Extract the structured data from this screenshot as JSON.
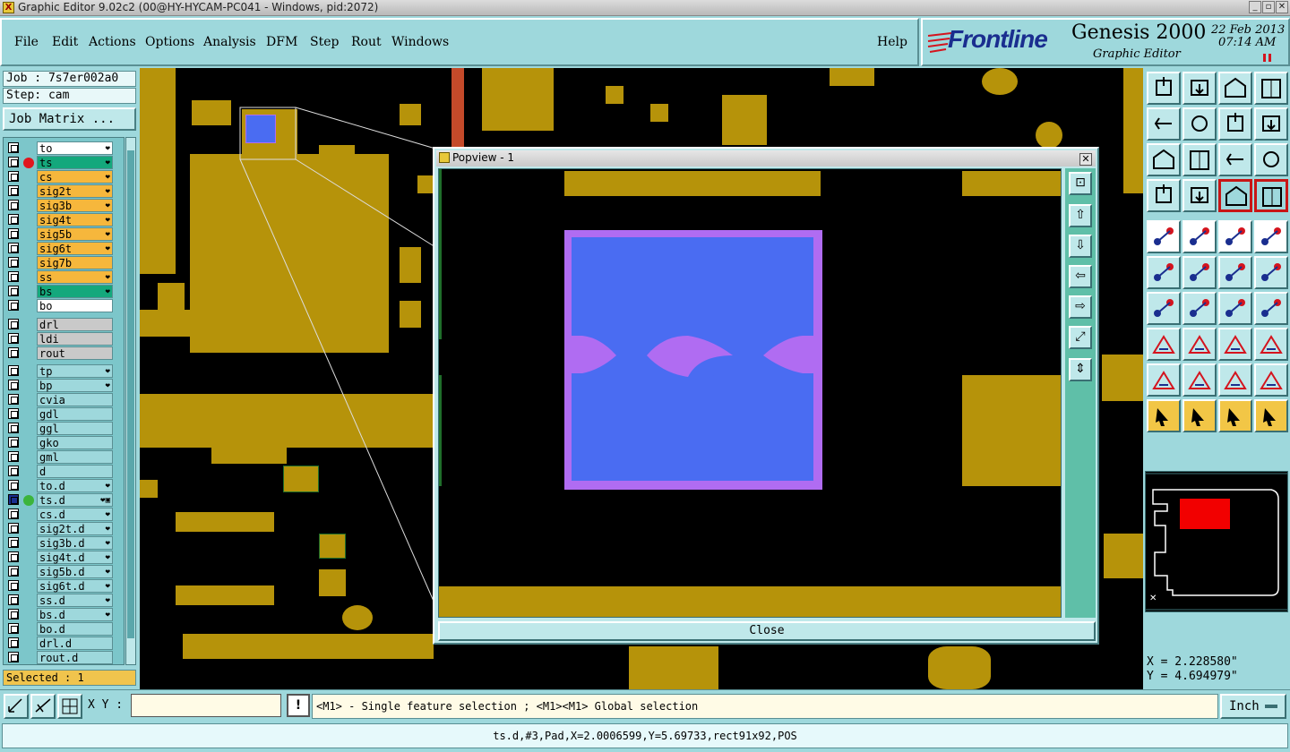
{
  "window": {
    "title": "Graphic Editor 9.02c2 (00@HY-HYCAM-PC041 - Windows, pid:2072)"
  },
  "menu": {
    "items": [
      {
        "label": "File"
      },
      {
        "label": "Edit"
      },
      {
        "label": "Actions"
      },
      {
        "label": "Options"
      },
      {
        "label": "Analysis"
      },
      {
        "label": "DFM"
      },
      {
        "label": "Step"
      },
      {
        "label": "Rout"
      },
      {
        "label": "Windows"
      },
      {
        "label": "Help"
      }
    ]
  },
  "brand": {
    "logo_text": "Frontline",
    "product": "Genesis 2000",
    "subtitle": "Graphic Editor",
    "date": "22 Feb 2013",
    "time": "07:14 AM"
  },
  "job": {
    "job_label": "Job : 7s7er002a0",
    "step_label": "Step: cam",
    "matrix_button": "Job Matrix ..."
  },
  "layers": {
    "group1": [
      {
        "name": "to",
        "color": "#ffffff",
        "mark": "❤"
      },
      {
        "name": "ts",
        "color": "#14a87c",
        "mark": "❤",
        "active": true
      },
      {
        "name": "cs",
        "color": "#f6b73c",
        "mark": "❤"
      },
      {
        "name": "sig2t",
        "color": "#f6b73c",
        "mark": "❤"
      },
      {
        "name": "sig3b",
        "color": "#f6b73c",
        "mark": "❤"
      },
      {
        "name": "sig4t",
        "color": "#f6b73c",
        "mark": "❤"
      },
      {
        "name": "sig5b",
        "color": "#f6b73c",
        "mark": "❤"
      },
      {
        "name": "sig6t",
        "color": "#f6b73c",
        "mark": "❤"
      },
      {
        "name": "sig7b",
        "color": "#f6b73c",
        "mark": ""
      },
      {
        "name": "ss",
        "color": "#f6b73c",
        "mark": "❤"
      },
      {
        "name": "bs",
        "color": "#14a87c",
        "mark": "❤"
      },
      {
        "name": "bo",
        "color": "#ffffff",
        "mark": ""
      }
    ],
    "group2": [
      {
        "name": "drl",
        "color": "#c9c9c9",
        "mark": ""
      },
      {
        "name": "ldi",
        "color": "#c9c9c9",
        "mark": ""
      },
      {
        "name": "rout",
        "color": "#c9c9c9",
        "mark": ""
      }
    ],
    "group3": [
      {
        "name": "tp",
        "color": "#9ed8dc",
        "mark": "❤"
      },
      {
        "name": "bp",
        "color": "#9ed8dc",
        "mark": "❤"
      },
      {
        "name": "cvia",
        "color": "#9ed8dc",
        "mark": ""
      },
      {
        "name": "gdl",
        "color": "#9ed8dc",
        "mark": ""
      },
      {
        "name": "ggl",
        "color": "#9ed8dc",
        "mark": ""
      },
      {
        "name": "gko",
        "color": "#9ed8dc",
        "mark": ""
      },
      {
        "name": "gml",
        "color": "#9ed8dc",
        "mark": ""
      },
      {
        "name": "d",
        "color": "#9ed8dc",
        "mark": ""
      },
      {
        "name": "to.d",
        "color": "#9ed8dc",
        "mark": "❤"
      },
      {
        "name": "ts.d",
        "color": "#9ed8dc",
        "mark": "❤▣",
        "edit": true
      },
      {
        "name": "cs.d",
        "color": "#9ed8dc",
        "mark": "❤"
      },
      {
        "name": "sig2t.d",
        "color": "#9ed8dc",
        "mark": "❤"
      },
      {
        "name": "sig3b.d",
        "color": "#9ed8dc",
        "mark": "❤"
      },
      {
        "name": "sig4t.d",
        "color": "#9ed8dc",
        "mark": "❤"
      },
      {
        "name": "sig5b.d",
        "color": "#9ed8dc",
        "mark": "❤"
      },
      {
        "name": "sig6t.d",
        "color": "#9ed8dc",
        "mark": "❤"
      },
      {
        "name": "ss.d",
        "color": "#9ed8dc",
        "mark": "❤"
      },
      {
        "name": "bs.d",
        "color": "#9ed8dc",
        "mark": "❤"
      },
      {
        "name": "bo.d",
        "color": "#9ed8dc",
        "mark": ""
      },
      {
        "name": "drl.d",
        "color": "#9ed8dc",
        "mark": ""
      },
      {
        "name": "rout.d",
        "color": "#9ed8dc",
        "mark": ""
      }
    ]
  },
  "selection": {
    "label": "Selected : 1"
  },
  "popview": {
    "title": "Popview - 1",
    "close_label": "Close"
  },
  "coords": {
    "x_label": "X = 2.228580\"",
    "y_label": "Y = 4.694979\""
  },
  "bottom": {
    "xy_label": "X Y :",
    "xy_value": "",
    "hint": "<M1> - Single feature selection ; <M1><M1> Global selection",
    "unit": "Inch",
    "status": "ts.d,#3,Pad,X=2.0006599,Y=5.69733,rect91x92,POS"
  },
  "colors": {
    "background": "#9ed8dc",
    "pad_copper": "#b6930a",
    "selected_pad": "#4a6cf2",
    "highlight": "#b06cf2",
    "active_layer": "#14a87c",
    "signal_layer": "#f6b73c"
  },
  "icons": {
    "left_bottom": [
      "zoom-box-icon",
      "draw-edit-icon",
      "snap-grid-icon"
    ],
    "pop_tools": [
      "zoom-fit-icon",
      "pan-up-icon",
      "pan-down-icon",
      "pan-left-icon",
      "pan-right-icon",
      "zoom-home-icon",
      "zoom-in-out-icon"
    ]
  }
}
